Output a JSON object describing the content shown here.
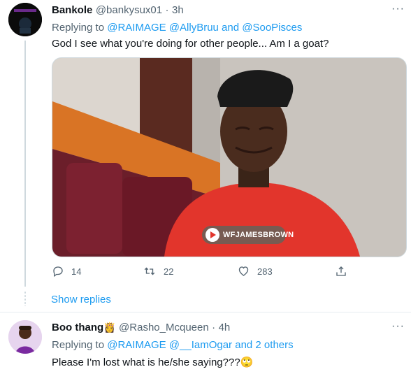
{
  "tweet1": {
    "name": "Bankole",
    "handle": "@bankysux01",
    "dot": "·",
    "time": "3h",
    "replying_prefix": "Replying to ",
    "replying_to": "@RAIMAGE @AllyBruu",
    "replying_and": " and ",
    "replying_last": "@SooPisces",
    "text": "God I see what you're doing for other people... Am I a goat?",
    "video_watermark": "WFJAMESBROWN",
    "reply_count": "14",
    "retweet_count": "22",
    "like_count": "283",
    "show_replies": "Show replies"
  },
  "tweet2": {
    "name": "Boo thang",
    "name_emoji": "👸",
    "handle": "@Rasho_Mcqueen",
    "dot": "·",
    "time": "4h",
    "replying_prefix": "Replying to ",
    "replying_to": "@RAIMAGE @__IamOgar",
    "replying_and": " and 2 others",
    "text": "Please I'm lost what is he/she saying???",
    "text_emoji": "🙄"
  },
  "icons": {
    "more": "more-icon",
    "reply": "reply-icon",
    "retweet": "retweet-icon",
    "like": "like-icon",
    "share": "share-icon"
  },
  "colors": {
    "link": "#1d9bf0",
    "muted": "#536471",
    "text": "#0f1419"
  }
}
